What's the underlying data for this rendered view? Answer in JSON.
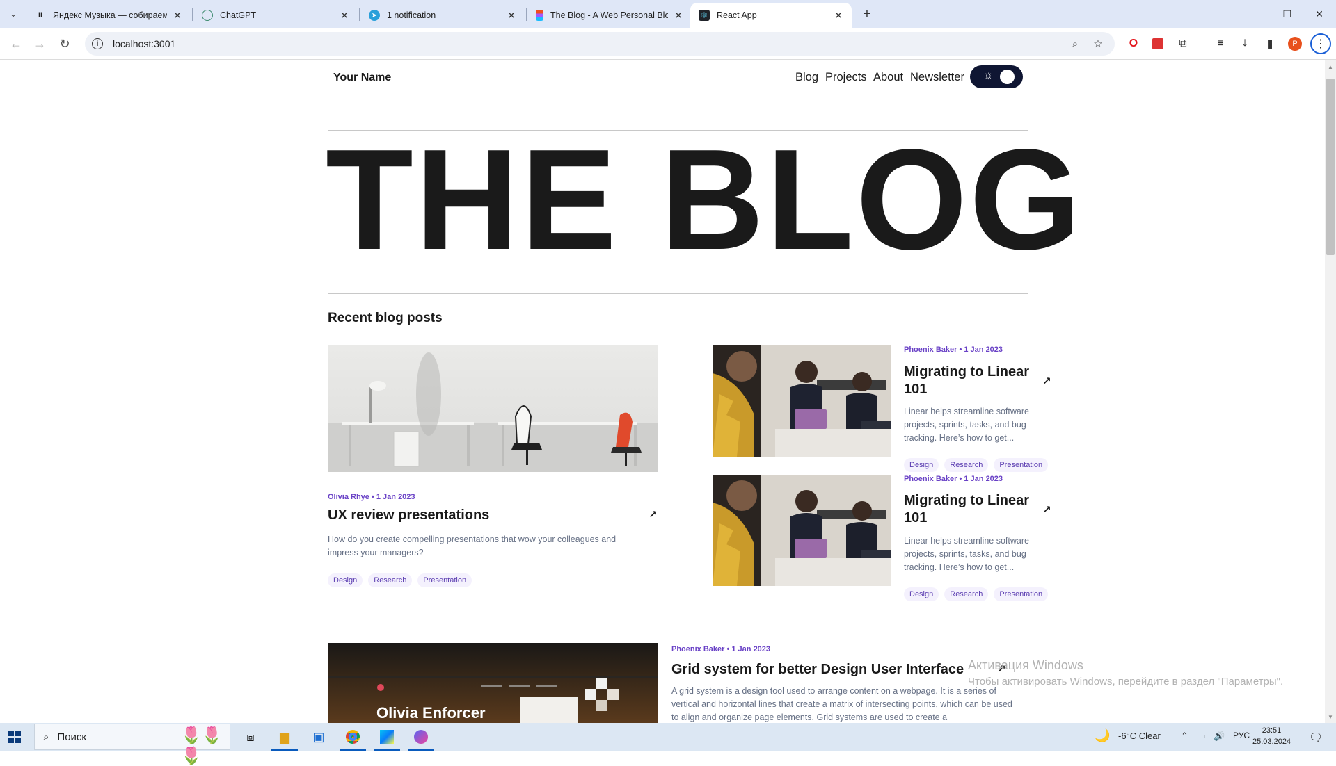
{
  "browser": {
    "tabs": [
      {
        "title": "Яндекс Музыка — собираем м",
        "icon": "pause-icon"
      },
      {
        "title": "ChatGPT",
        "icon": "chatgpt-icon"
      },
      {
        "title": "1 notification",
        "icon": "telegram-icon"
      },
      {
        "title": "The Blog - A Web Personal Blog",
        "icon": "figma-icon"
      },
      {
        "title": "React App",
        "icon": "react-icon",
        "active": true
      }
    ],
    "url": "localhost:3001",
    "profile_initial": "P"
  },
  "site": {
    "name": "Your Name",
    "nav": [
      "Blog",
      "Projects",
      "About",
      "Newsletter"
    ],
    "hero": "THE BLOG",
    "section_title": "Recent blog posts"
  },
  "posts": {
    "featured": {
      "meta": "Olivia Rhye • 1 Jan 2023",
      "title": "UX review presentations",
      "desc": "How do you create compelling presentations that wow your colleagues and impress your managers?",
      "tags": [
        "Design",
        "Research",
        "Presentation"
      ]
    },
    "side": [
      {
        "meta": "Phoenix Baker • 1 Jan 2023",
        "title": "Migrating to Linear 101",
        "desc": "Linear helps streamline software projects, sprints, tasks, and bug tracking. Here’s how to get...",
        "tags": [
          "Design",
          "Research",
          "Presentation"
        ]
      },
      {
        "meta": "Phoenix Baker • 1 Jan 2023",
        "title": "Migrating to Linear 101",
        "desc": "Linear helps streamline software projects, sprints, tasks, and bug tracking. Here’s how to get...",
        "tags": [
          "Design",
          "Research",
          "Presentation"
        ]
      }
    ],
    "wide": {
      "meta": "Phoenix Baker • 1 Jan 2023",
      "title": "Grid system for better Design User Interface",
      "desc": "A grid system is a design tool used to arrange content on a webpage. It is a series of vertical and horizontal lines that create a matrix of intersecting points, which can be used to align and organize page elements. Grid systems are used to create a",
      "image_text": "Olivia Enforcer"
    }
  },
  "watermark": {
    "line1": "Активация Windows",
    "line2": "Чтобы активировать Windows, перейдите в раздел \"Параметры\"."
  },
  "taskbar": {
    "search": "Поиск",
    "weather": "-6°C  Clear",
    "lang": "РУС",
    "time": "23:51",
    "date": "25.03.2024"
  },
  "colors": {
    "accent": "#6941c6",
    "toggle_bg": "#0f1633",
    "tag_bg": "#f4f1fd"
  }
}
